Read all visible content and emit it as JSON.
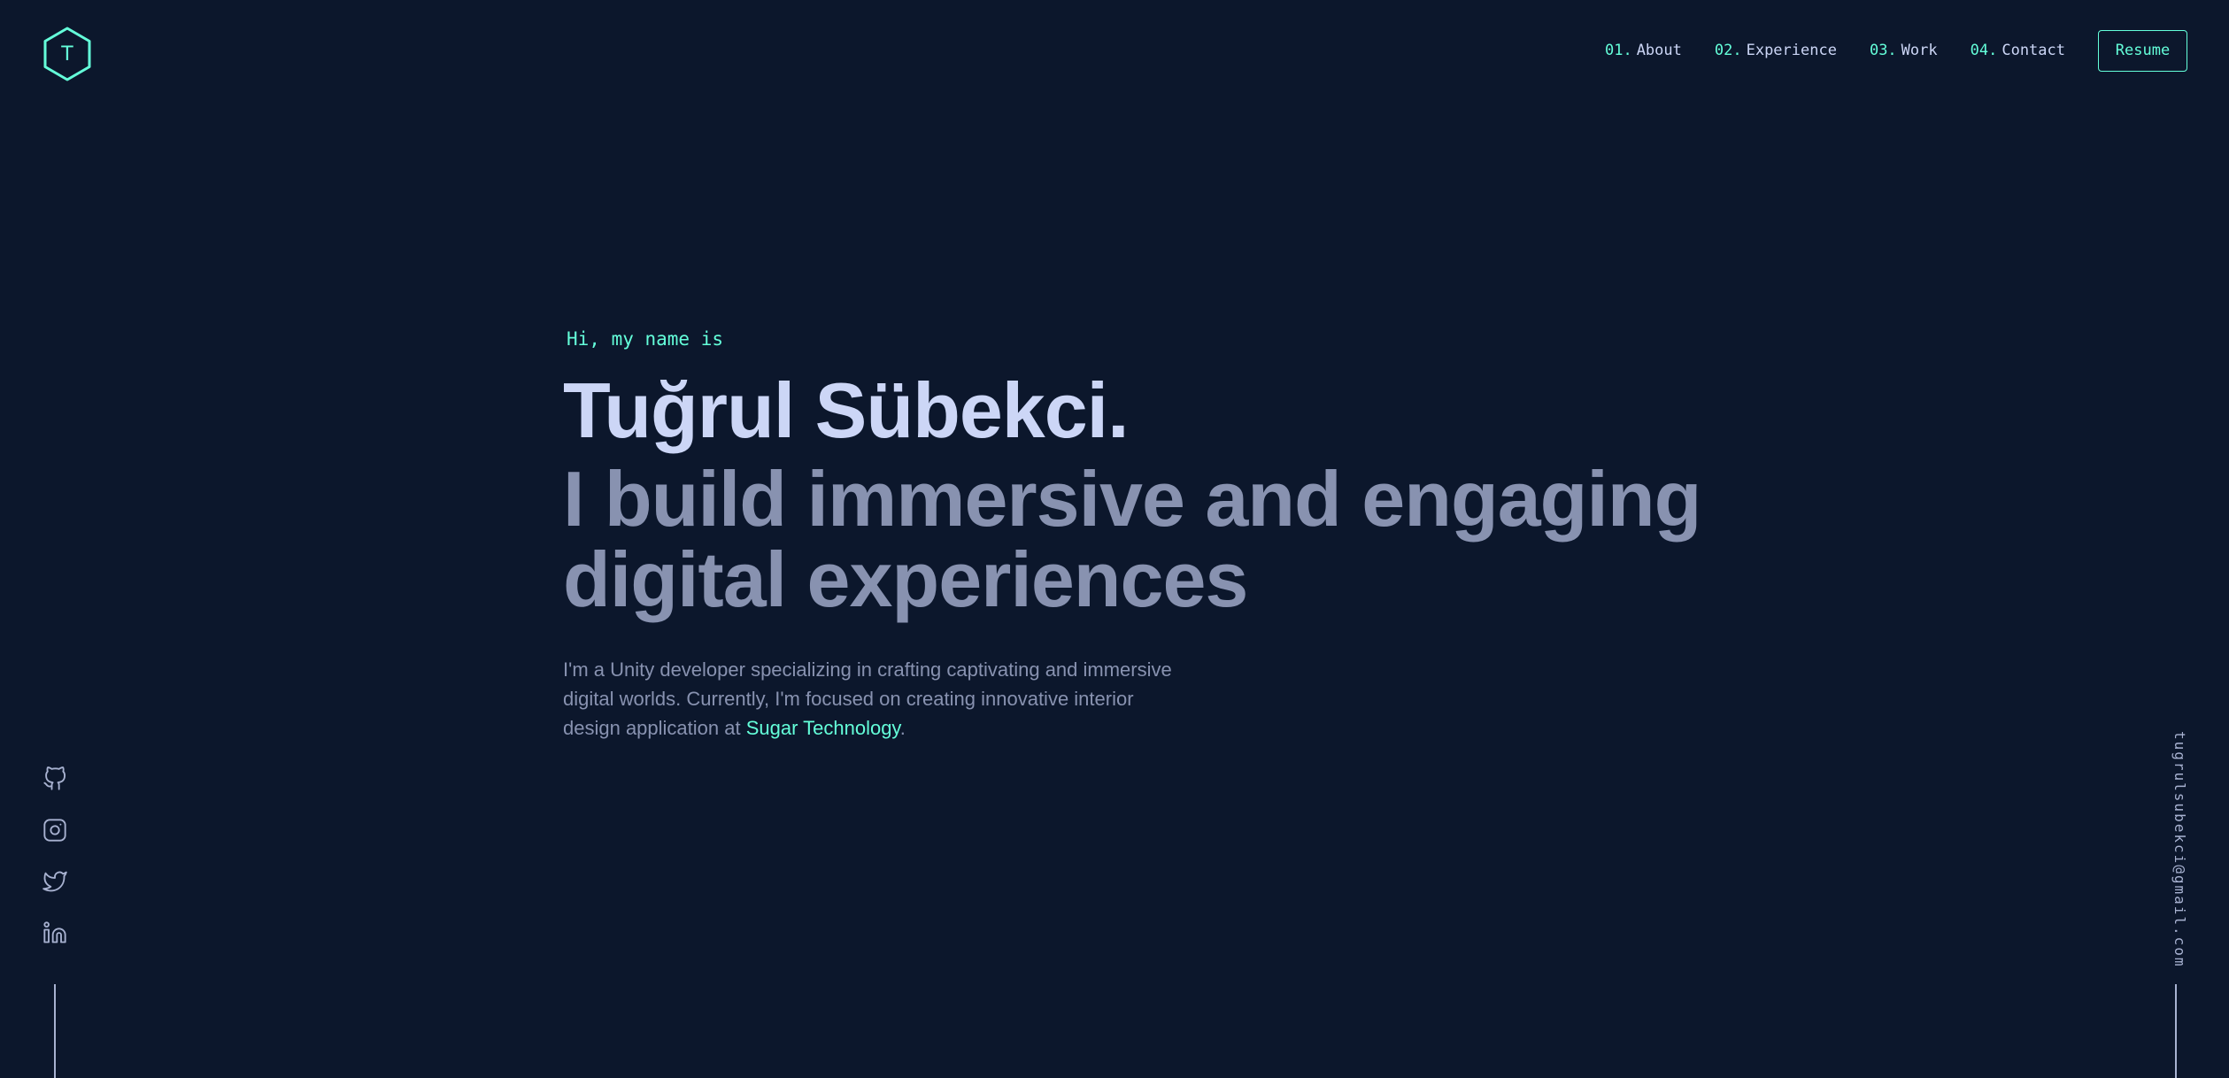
{
  "header": {
    "logo": {
      "letter": "T",
      "icon": "hexagon-logo-icon"
    },
    "nav": [
      {
        "num": "01.",
        "label": "About"
      },
      {
        "num": "02.",
        "label": "Experience"
      },
      {
        "num": "03.",
        "label": "Work"
      },
      {
        "num": "04.",
        "label": "Contact"
      }
    ],
    "resume_label": "Resume"
  },
  "hero": {
    "greeting": "Hi, my name is",
    "name": "Tuğrul Sübekci.",
    "tagline": "I build immersive and engaging digital experiences",
    "intro_text": "I'm a Unity developer specializing in crafting captivating and immersive digital worlds. Currently, I'm focused on creating innovative interior design application at ",
    "intro_link": "Sugar Technology",
    "intro_end": "."
  },
  "social": [
    {
      "icon": "github-icon"
    },
    {
      "icon": "instagram-icon"
    },
    {
      "icon": "twitter-icon"
    },
    {
      "icon": "linkedin-icon"
    }
  ],
  "email": "tugrulsubekci@gmail.com",
  "colors": {
    "background": "#0c172c",
    "accent": "#64ffda",
    "heading": "#ccd6f6",
    "text": "#8892b0",
    "light": "#a8b2d1"
  }
}
